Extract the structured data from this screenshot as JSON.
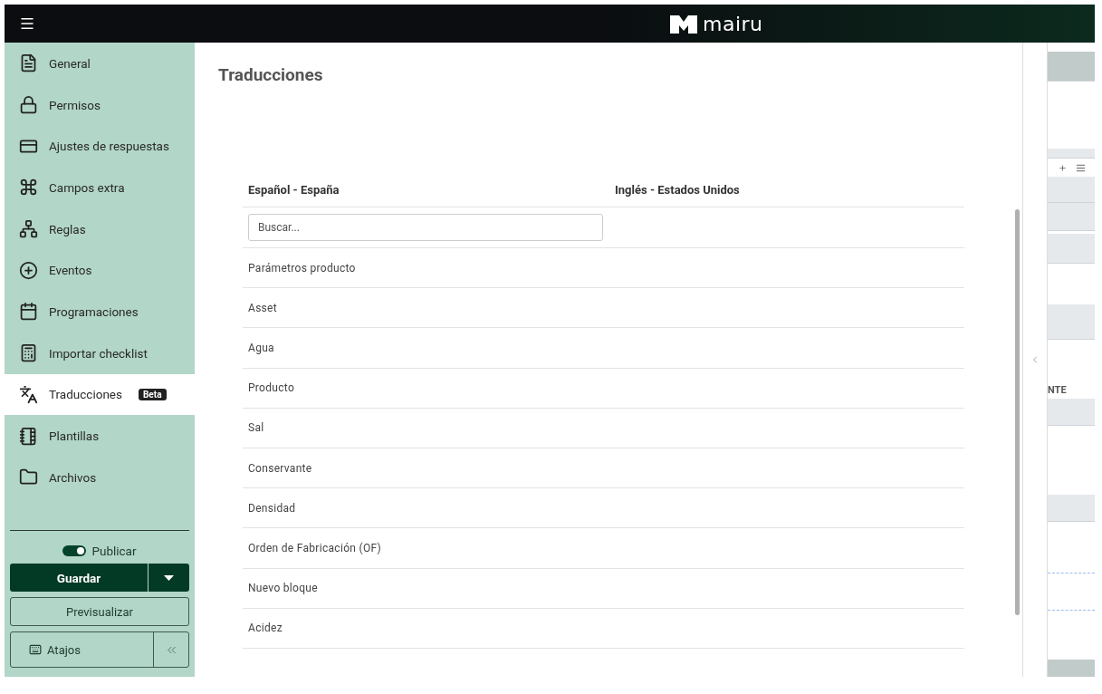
{
  "brand": {
    "name": "mairu"
  },
  "sidebar": {
    "items": [
      {
        "label": "General",
        "selected": false
      },
      {
        "label": "Permisos",
        "selected": false
      },
      {
        "label": "Ajustes de respuestas",
        "selected": false
      },
      {
        "label": "Campos extra",
        "selected": false
      },
      {
        "label": "Reglas",
        "selected": false
      },
      {
        "label": "Eventos",
        "selected": false
      },
      {
        "label": "Programaciones",
        "selected": false
      },
      {
        "label": "Importar checklist",
        "selected": false
      },
      {
        "label": "Traducciones",
        "selected": true,
        "badge": "Beta"
      },
      {
        "label": "Plantillas",
        "selected": false
      },
      {
        "label": "Archivos",
        "selected": false
      }
    ],
    "publish": {
      "label": "Publicar",
      "on": true
    },
    "save_button": "Guardar",
    "preview_button": "Previsualizar",
    "shortcuts_button": "Atajos"
  },
  "page": {
    "title": "Traducciones",
    "table": {
      "columns": [
        "Español - España",
        "Inglés - Estados Unidos"
      ],
      "search": {
        "placeholder": "Buscar..."
      },
      "rows": [
        "Parámetros producto",
        "Asset",
        "Agua",
        "Producto",
        "Sal",
        "Conservante",
        "Densidad",
        "Orden de Fabricación (OF)",
        "Nuevo bloque",
        "Acidez"
      ]
    }
  },
  "preview_strip": {
    "heading": "NTE"
  }
}
